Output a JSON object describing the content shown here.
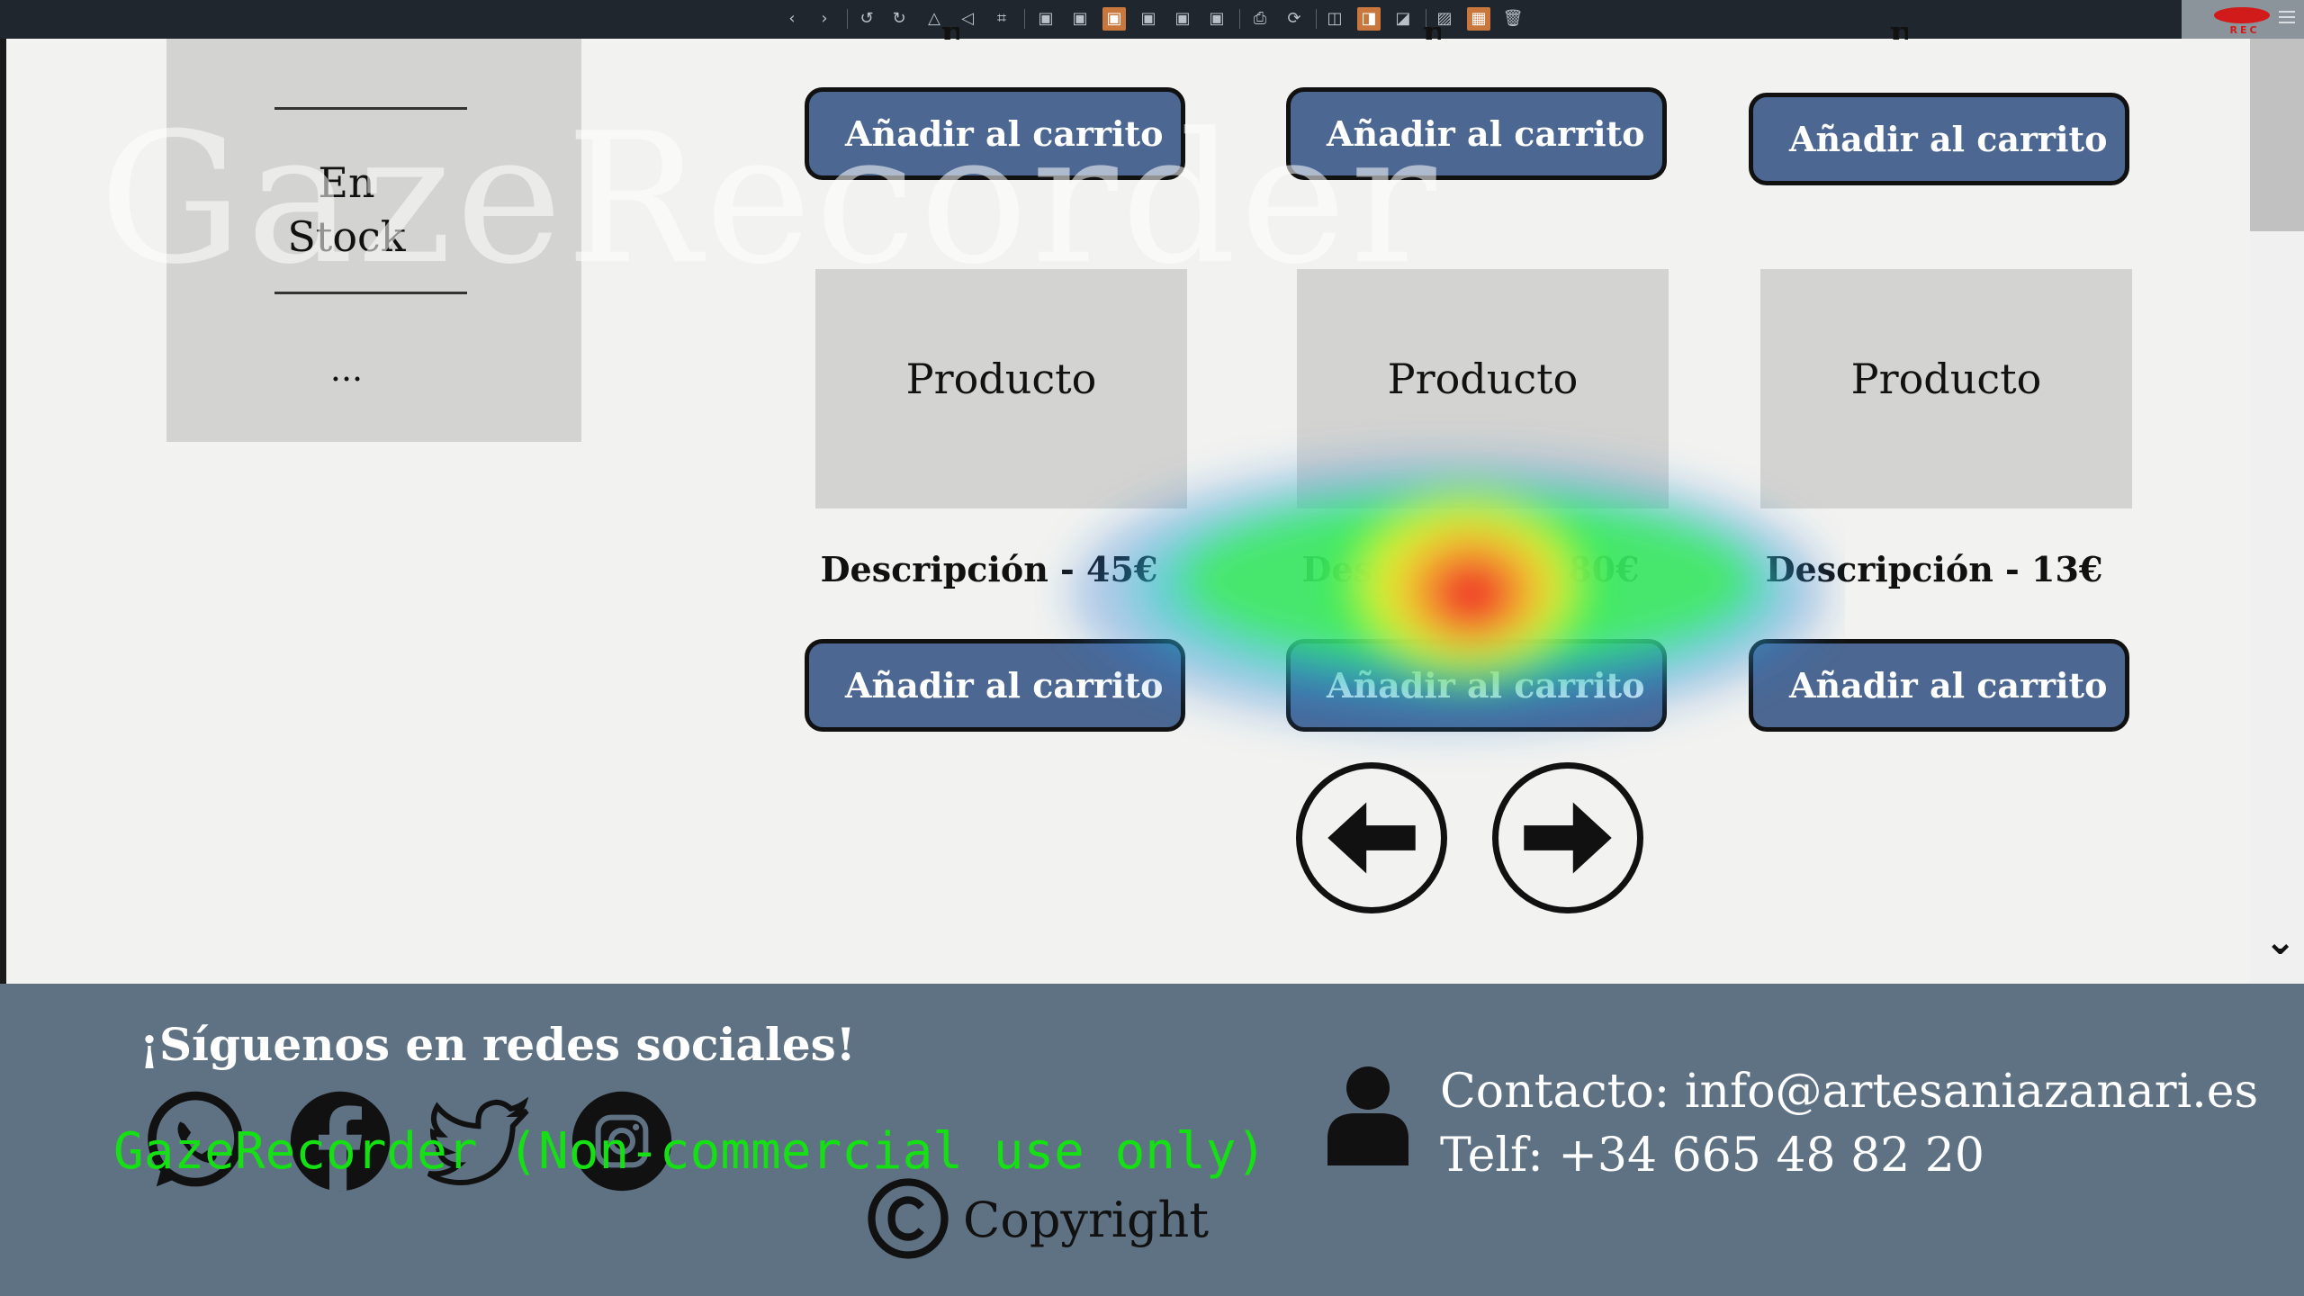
{
  "toolbar": {
    "icons": [
      "chevron-left-icon",
      "chevron-right-icon",
      "undo-icon",
      "redo-icon",
      "flip-icon",
      "rotate-icon",
      "crop-icon",
      "filter-1-icon",
      "filter-2-icon",
      "filter-3-icon",
      "filter-4-icon",
      "filter-5-icon",
      "filter-6-icon",
      "print-icon",
      "refresh-icon",
      "layout-1-icon",
      "layout-2-icon",
      "window-icon",
      "image-icon",
      "grid-icon",
      "trash-icon"
    ],
    "active_color": "#c9773c"
  },
  "recorder": {
    "label": "REC"
  },
  "filter_panel": {
    "stock_label": "En Stock",
    "more_label": "..."
  },
  "watermark": "GazeRecorder",
  "products": [
    {
      "name": "Producto",
      "description": "Descripción - 45€",
      "button": "Añadir al carrito"
    },
    {
      "name": "Producto",
      "description": "Descripción - 80€",
      "button": "Añadir al carrito"
    },
    {
      "name": "Producto",
      "description": "Descripción - 13€",
      "button": "Añadir al carrito"
    }
  ],
  "top_row_buttons": [
    "Añadir al carrito",
    "Añadir al carrito",
    "Añadir al carrito"
  ],
  "cropped_price_chars": [
    "p",
    "p",
    "p"
  ],
  "footer": {
    "social_title": "¡Síguenos en redes sociales!",
    "social_icons": [
      "whatsapp-icon",
      "facebook-icon",
      "twitter-icon",
      "instagram-icon"
    ],
    "overlay_text": "GazeRecorder (Non-commercial use only)",
    "copyright": "Copyright",
    "contact_email": "Contacto: info@artesaniazanari.es",
    "contact_phone": "Telf: +34 665 48 82 20"
  },
  "colors": {
    "button_bg": "#4c6792",
    "footer_bg": "#5f7284",
    "panel_bg": "#d3d3d1",
    "page_bg": "#f2f2f0",
    "overlay_green": "#14e014"
  }
}
